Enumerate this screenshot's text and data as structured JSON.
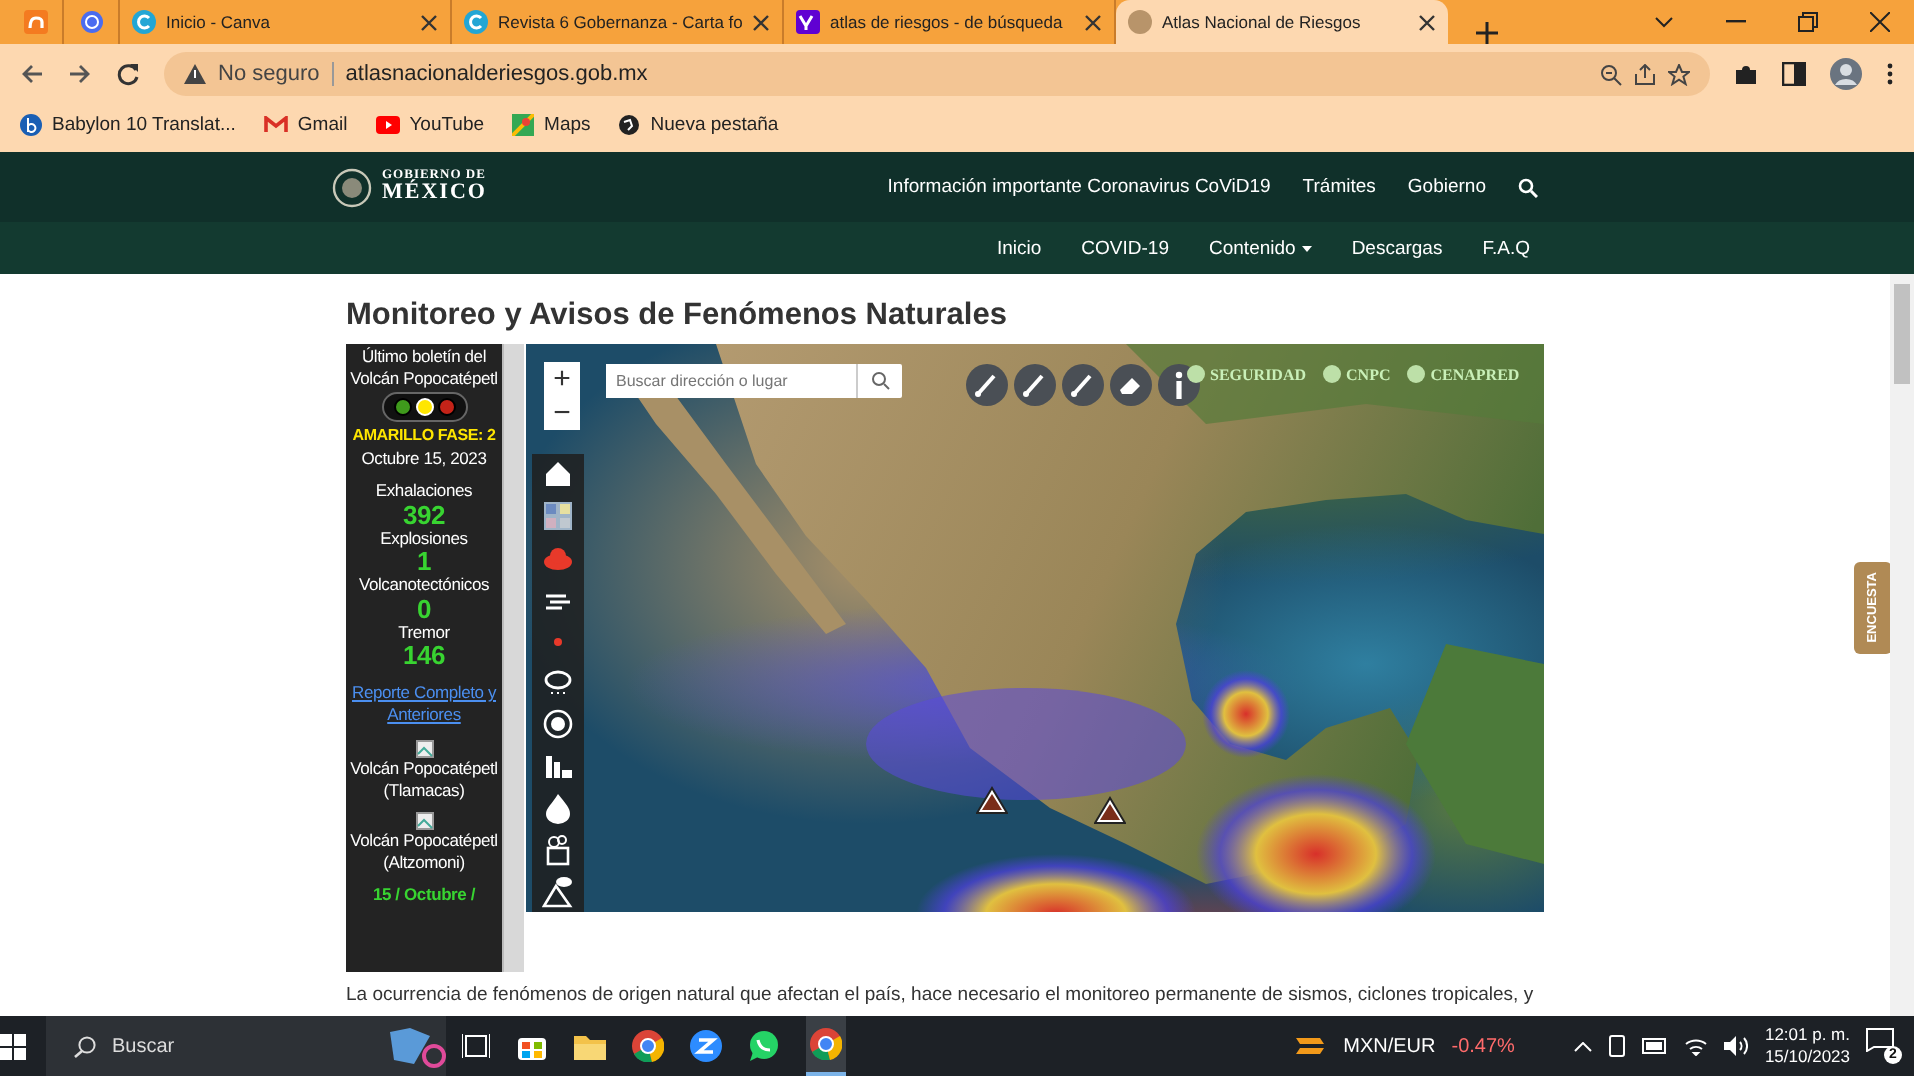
{
  "browser": {
    "tabs": [
      {
        "kind": "pinned",
        "selected": false
      },
      {
        "kind": "pinned",
        "selected": false
      },
      {
        "kind": "normal",
        "title": "Inicio - Canva",
        "selected": false
      },
      {
        "kind": "normal",
        "title": "Revista 6 Gobernanza - Carta fo",
        "selected": false
      },
      {
        "kind": "normal",
        "title": "atlas de riesgos - de búsqueda",
        "selected": false
      },
      {
        "kind": "normal",
        "title": "Atlas Nacional de Riesgos",
        "selected": true
      }
    ],
    "security": "No seguro",
    "url": "atlasnacionalderiesgos.gob.mx",
    "bookmarks": [
      "Babylon 10 Translat...",
      "Gmail",
      "YouTube",
      "Maps",
      "Nueva pestaña"
    ]
  },
  "header": {
    "logo_top": "GOBIERNO DE",
    "logo_bottom": "MÉXICO",
    "top_links": [
      "Información importante Coronavirus CoViD19",
      "Trámites",
      "Gobierno"
    ],
    "nav": [
      {
        "label": "Inicio",
        "dropdown": false
      },
      {
        "label": "COVID-19",
        "dropdown": false
      },
      {
        "label": "Contenido",
        "dropdown": true
      },
      {
        "label": "Descargas",
        "dropdown": false
      },
      {
        "label": "F.A.Q",
        "dropdown": false
      }
    ]
  },
  "page_title": "Monitoreo y Avisos de Fenómenos Naturales",
  "volcano_panel": {
    "title": "Último boletín del Volcán Popocatépetl",
    "lights": [
      {
        "color": "#3f9a1c",
        "on": false
      },
      {
        "color": "#ffe600",
        "on": true
      },
      {
        "color": "#c42318",
        "on": false
      }
    ],
    "phase": "AMARILLO FASE: 2",
    "date": "Octubre 15, 2023",
    "stats": [
      {
        "label": "Exhalaciones",
        "value": "392"
      },
      {
        "label": "Explosiones",
        "value": "1"
      },
      {
        "label": "Volcanotectónicos",
        "value": "0"
      },
      {
        "label": "Tremor",
        "value": "146"
      }
    ],
    "report_link": "Reporte Completo y Anteriores",
    "cameras": [
      {
        "caption": "Volcán Popocatépetl (Tlamacas)"
      },
      {
        "caption": "Volcán Popocatépetl (Altzomoni)"
      }
    ],
    "camera_date": "15 / Octubre /"
  },
  "map": {
    "zoom_in": "+",
    "zoom_out": "−",
    "search_placeholder": "Buscar dirección o lugar",
    "logos": [
      "SEGURIDAD",
      "CNPC",
      "CENAPRED"
    ]
  },
  "survey_tab": "ENCUESTA",
  "intro_text": "La ocurrencia de fenómenos de origen natural que afectan el país, hace necesario el monitoreo permanente de sismos, ciclones tropicales, y",
  "taskbar": {
    "search": "Buscar",
    "currency": "MXN/EUR",
    "change": "-0.47%",
    "time": "12:01 p. m.",
    "date": "15/10/2023",
    "notifications": "2"
  }
}
